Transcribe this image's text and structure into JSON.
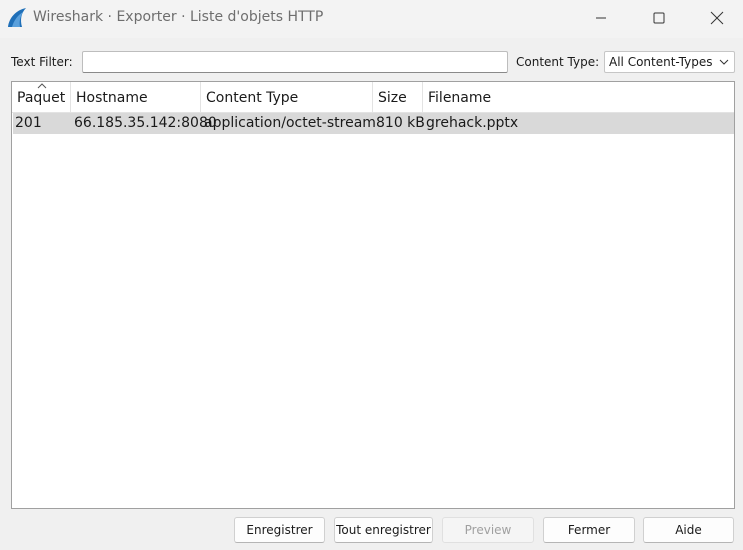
{
  "window": {
    "title": "Wireshark · Exporter · Liste d'objets HTTP",
    "icon": "wireshark-fin-icon",
    "controls": [
      "minimize-icon",
      "maximize-icon",
      "close-icon"
    ]
  },
  "filter": {
    "label": "Text Filter:",
    "value": "",
    "placeholder": ""
  },
  "content_type": {
    "label": "Content Type:",
    "selected": "All Content-Types"
  },
  "table": {
    "columns": [
      "Paquet",
      "Hostname",
      "Content Type",
      "Size",
      "Filename"
    ],
    "sort_column": "Paquet",
    "rows": [
      {
        "paquet": "201",
        "hostname": "66.185.35.142:8080",
        "content_type": "application/octet-stream",
        "size": "810 kB",
        "filename": "grehack.pptx",
        "selected": true
      }
    ]
  },
  "buttons": {
    "save": "Enregistrer",
    "save_all": "Tout enregistrer",
    "preview": "Preview",
    "close": "Fermer",
    "help": "Aide"
  },
  "colors": {
    "accent": "#1f6fb8",
    "selected_row": "#d9d9d9"
  }
}
